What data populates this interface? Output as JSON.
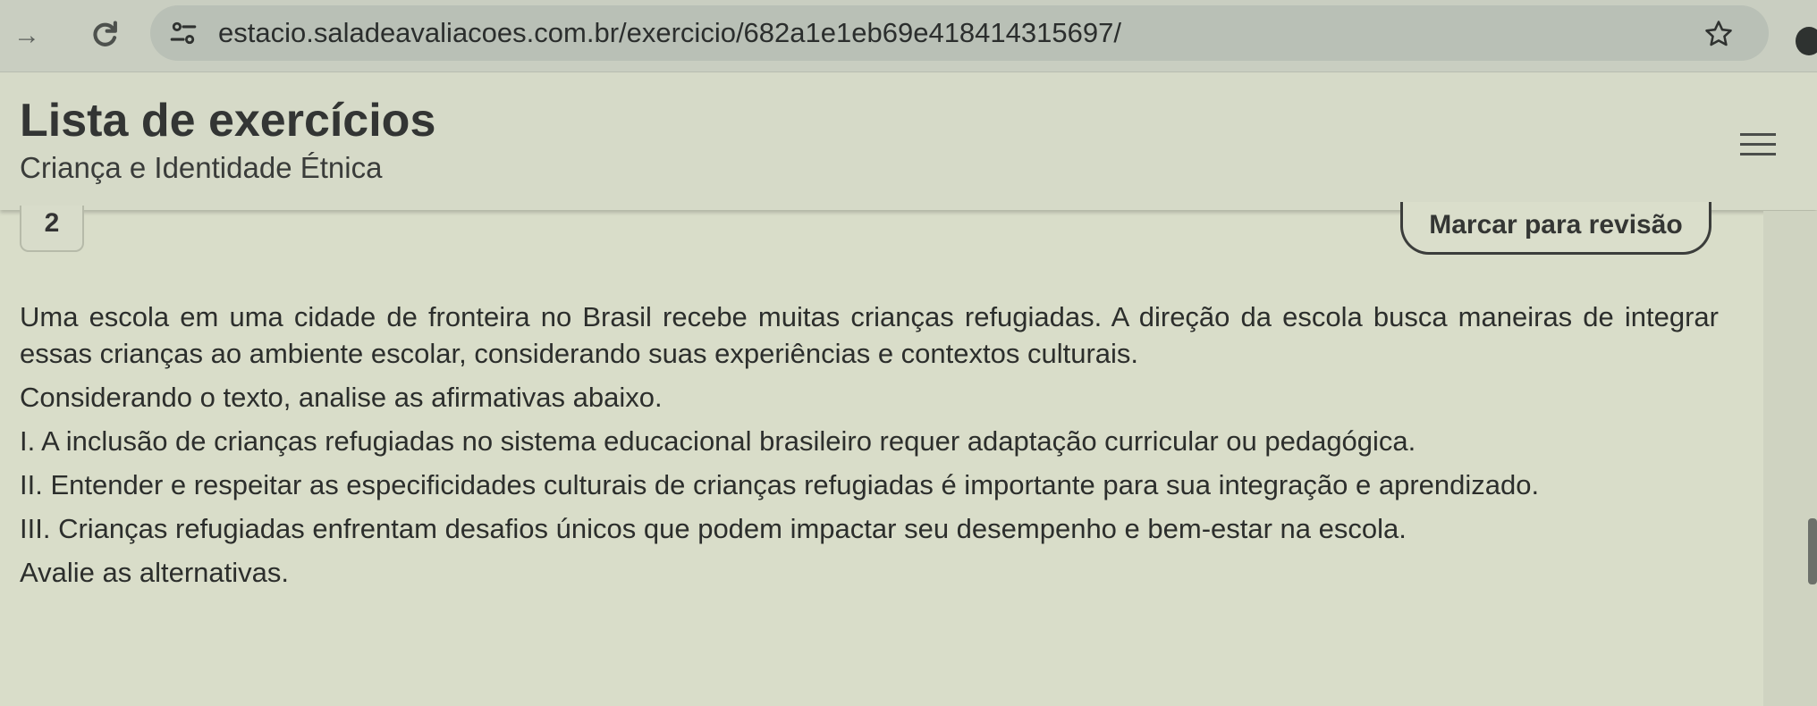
{
  "browser": {
    "url": "estacio.saladeavaliacoes.com.br/exercicio/682a1e1eb69e418414315697/"
  },
  "header": {
    "title": "Lista de exercícios",
    "subtitle": "Criança e Identidade Étnica"
  },
  "question": {
    "number": "2",
    "review_label": "Marcar para revisão",
    "paragraphs": [
      "Uma escola em uma cidade de fronteira no Brasil recebe muitas crianças refugiadas. A direção da escola busca maneiras de integrar essas crianças ao ambiente escolar, considerando suas experiências e contextos culturais.",
      "Considerando o texto, analise as afirmativas abaixo.",
      "I. A inclusão de crianças refugiadas no sistema educacional brasileiro requer adaptação curricular ou pedagógica.",
      "II. Entender e respeitar as especificidades culturais de crianças refugiadas é importante para sua integração e aprendizado.",
      "III. Crianças refugiadas enfrentam desafios únicos que podem impactar seu desempenho e bem-estar na escola.",
      "Avalie as alternativas."
    ]
  },
  "icons": {
    "forward": "arrow-forward-icon",
    "reload": "reload-icon",
    "site_info": "tune-icon",
    "bookmark": "star-icon",
    "menu": "hamburger-menu-icon"
  },
  "colors": {
    "background": "#d9ddc9",
    "chrome": "#c9cec1",
    "text": "#2a2c2b"
  }
}
